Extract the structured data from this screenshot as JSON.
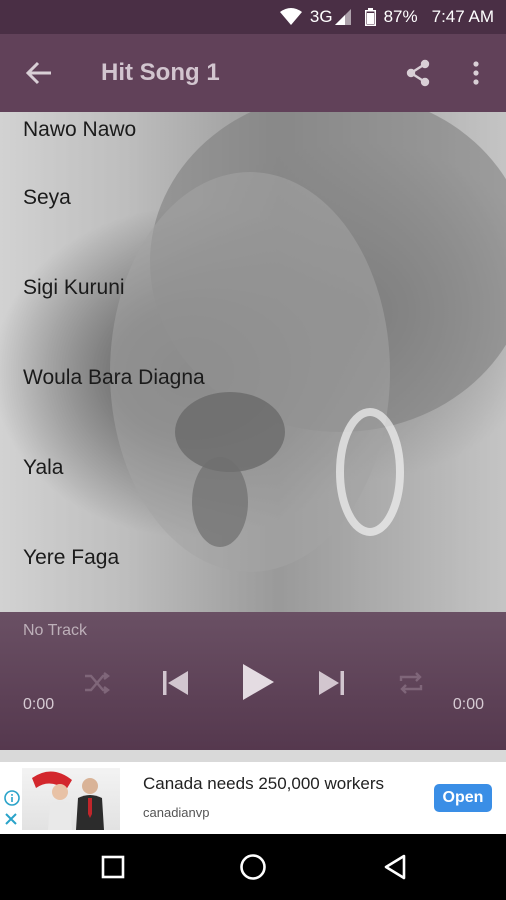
{
  "status_bar": {
    "network": "3G",
    "battery": "87%",
    "time": "7:47 AM"
  },
  "app_bar": {
    "title": "Hit Song 1",
    "icons": [
      "back-arrow-icon",
      "share-icon",
      "more-vert-icon"
    ]
  },
  "tracks": [
    {
      "label": "Nawo Nawo"
    },
    {
      "label": "Seya"
    },
    {
      "label": "Sigi Kuruni"
    },
    {
      "label": "Woula Bara Diagna"
    },
    {
      "label": "Yala"
    },
    {
      "label": "Yere Faga"
    }
  ],
  "player": {
    "now_playing": "No Track",
    "elapsed": "0:00",
    "duration": "0:00",
    "icons": [
      "shuffle-icon",
      "skip-previous-icon",
      "play-icon",
      "skip-next-icon",
      "repeat-icon"
    ]
  },
  "ad": {
    "title": "Canada needs 250,000 workers",
    "advertiser": "canadianvp",
    "cta": "Open"
  },
  "nav_bar": {
    "icons": [
      "recent-apps-icon",
      "home-icon",
      "back-icon"
    ]
  },
  "colors": {
    "status_bar": "#4a2f45",
    "app_bar": "#614159",
    "player": "#5f4459",
    "accent_button": "#3a8ee6"
  }
}
